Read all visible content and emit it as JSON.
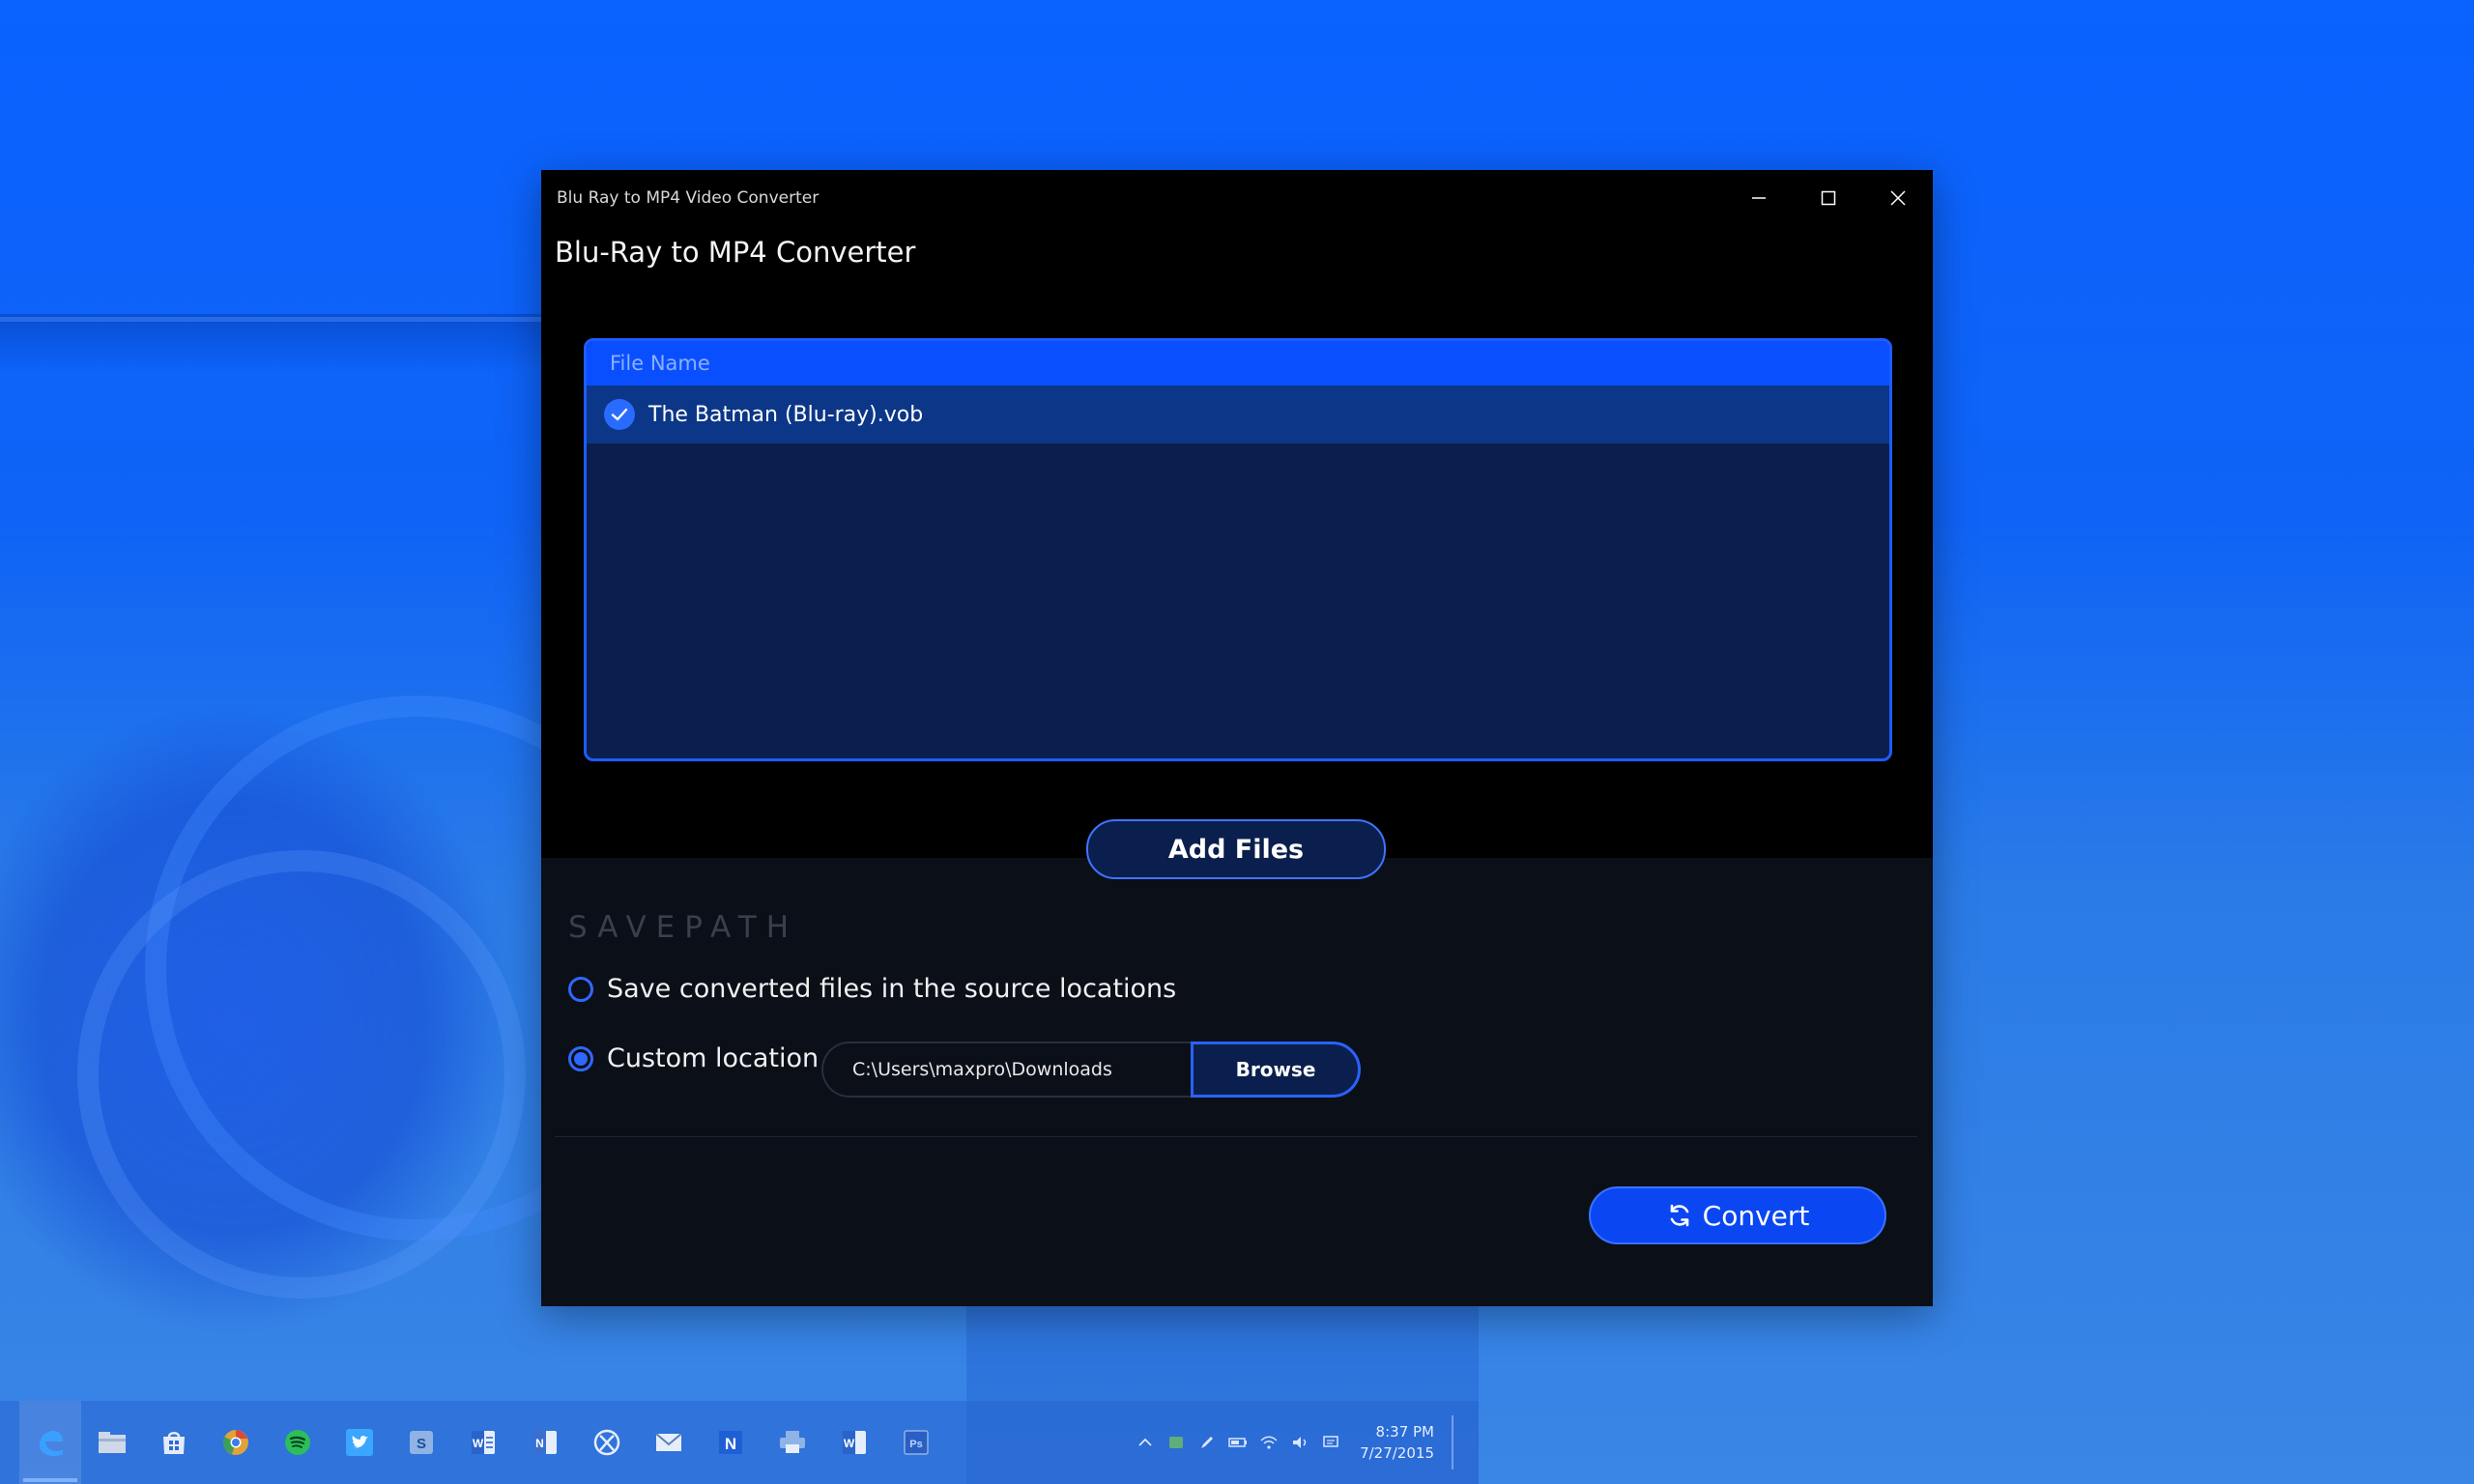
{
  "window": {
    "title": "Blu Ray to MP4 Video Converter"
  },
  "app": {
    "title": "Blu-Ray to MP4 Converter"
  },
  "file_list": {
    "column_header": "File Name",
    "files": [
      {
        "name": "The Batman (Blu-ray).vob",
        "checked": true
      }
    ]
  },
  "actions": {
    "add_files_label": "Add Files",
    "convert_label": "Convert"
  },
  "savepath": {
    "heading": "SAVEPATH",
    "option_source_label": "Save converted files in the source locations",
    "option_custom_label": "Custom location",
    "selected_option": "custom",
    "path_value": "C:\\Users\\maxpro\\Downloads",
    "browse_label": "Browse"
  },
  "taskbar": {
    "icons": [
      "edge-icon",
      "file-explorer-icon",
      "store-icon",
      "chrome-icon",
      "spotify-icon",
      "twitter-icon",
      "skype-icon",
      "word-icon",
      "onenote-icon",
      "xbox-icon",
      "mail-icon",
      "news-icon",
      "printer-icon",
      "word-icon",
      "photoshop-icon"
    ],
    "clock_time": "8:37 PM",
    "clock_date": "7/27/2015"
  },
  "colors": {
    "accent": "#0a4fff",
    "window_bg": "#0b0f18",
    "list_bg": "#0b1f4e",
    "selected_row": "#0c3788"
  }
}
